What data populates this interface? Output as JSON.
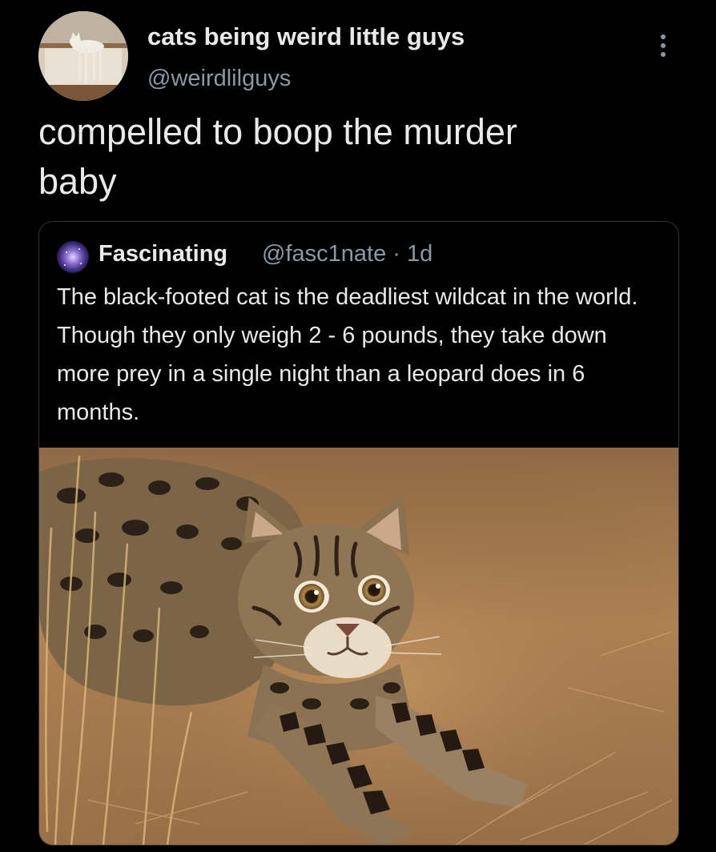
{
  "tweet": {
    "author": {
      "display_name": "cats being weird little guys",
      "handle": "@weirdlilguys",
      "avatar_icon": "cat-photo-avatar"
    },
    "more_icon": "more-vertical-icon",
    "text": "compelled to boop the murder\nbaby",
    "quoted": {
      "author": {
        "display_name": "Fascinating",
        "handle": "@fasc1nate",
        "separator": "·",
        "time": "1d",
        "avatar_icon": "galaxy-avatar"
      },
      "text": "The black-footed cat is the deadliest wildcat in the world. Though they only weigh 2 - 6 pounds, they take down more prey in a single night than a leopard does in 6 months.",
      "media": {
        "type": "photo",
        "subject": "black-footed-cat-photo"
      }
    }
  },
  "colors": {
    "background": "#000000",
    "primary_text": "#e7e9ea",
    "secondary_text": "#8b98a5",
    "border": "#2f3336",
    "photo_ground": "#a67a4f"
  }
}
